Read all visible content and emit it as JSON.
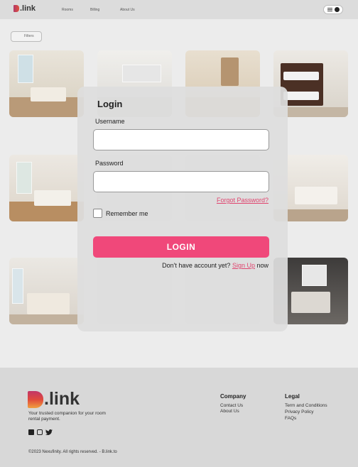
{
  "header": {
    "brand": ".link",
    "nav": [
      "Rooms",
      "Billing",
      "About Us"
    ]
  },
  "filters_label": "Filters",
  "login": {
    "title": "Login",
    "username_label": "Username",
    "username_value": "",
    "password_label": "Password",
    "password_value": "",
    "forgot": "Forgot Password?",
    "remember": "Remember me",
    "button": "LOGIN",
    "signup_prefix": "Don't have account yet?",
    "signup_link": "Sign Up",
    "signup_suffix": "now"
  },
  "footer": {
    "brand": ".link",
    "tagline": "Your trusted companion for your room rental payment.",
    "company_heading": "Company",
    "company_links": [
      "Contact Us",
      "About Us"
    ],
    "legal_heading": "Legal",
    "legal_links": [
      "Term and Conditions",
      "Privacy Policy",
      "FAQs"
    ],
    "copyright": "©2023 Nexufinity. All rights reserved. - B.link.to",
    "social_icons": [
      "facebook-icon",
      "instagram-icon",
      "twitter-icon"
    ]
  },
  "colors": {
    "accent": "#f0487a",
    "link": "#e0456f"
  }
}
